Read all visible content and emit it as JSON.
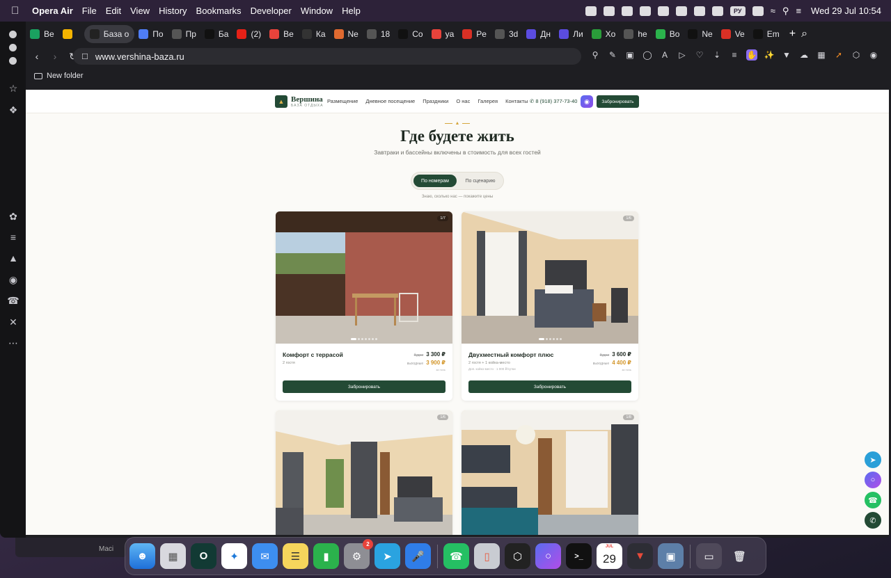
{
  "menubar": {
    "app": "Opera Air",
    "items": [
      "File",
      "Edit",
      "View",
      "History",
      "Bookmarks",
      "Developer",
      "Window",
      "Help"
    ],
    "lang": "РУ",
    "datetime": "Wed 29 Jul  10:54"
  },
  "tabs": [
    {
      "label": "Be",
      "color": "#1aa260",
      "icon": "sheets-icon"
    },
    {
      "label": "",
      "color": "#f5b400",
      "icon": "sun-icon"
    },
    {
      "label": "База о",
      "color": "#222222",
      "icon": "vershina-icon",
      "active": true
    },
    {
      "label": "По",
      "color": "#4f7df5",
      "icon": "spark-icon"
    },
    {
      "label": "Пр",
      "color": "#555555",
      "icon": "doc-icon"
    },
    {
      "label": "Ба",
      "color": "#111111",
      "icon": "vershina-icon"
    },
    {
      "label": "(2)",
      "color": "#e62117",
      "icon": "youtube-icon"
    },
    {
      "label": "Be",
      "color": "#e8433b",
      "icon": "pin-icon"
    },
    {
      "label": "Ка",
      "color": "#333333",
      "icon": "yandex-icon"
    },
    {
      "label": "Ne",
      "color": "#e06a30",
      "icon": "asterisk-icon"
    },
    {
      "label": "18",
      "color": "#555555",
      "icon": "doc-icon"
    },
    {
      "label": "Co",
      "color": "#111111",
      "icon": "notion-icon"
    },
    {
      "label": "ya",
      "color": "#e8433b",
      "icon": "yandex-y-icon"
    },
    {
      "label": "Pe",
      "color": "#d93025",
      "icon": "gmail-icon"
    },
    {
      "label": "3d",
      "color": "#555555",
      "icon": "doc-icon"
    },
    {
      "label": "Дн",
      "color": "#5b4ce0",
      "icon": "play-icon"
    },
    {
      "label": "Ли",
      "color": "#5b4ce0",
      "icon": "play-icon"
    },
    {
      "label": "Xo",
      "color": "#2a9d3a",
      "icon": "dollar-icon"
    },
    {
      "label": "he",
      "color": "#555555",
      "icon": "doc-icon"
    },
    {
      "label": "Bo",
      "color": "#2bb24c",
      "icon": "p-icon"
    },
    {
      "label": "Ne",
      "color": "#111111",
      "icon": "vershina-icon"
    },
    {
      "label": "Ve",
      "color": "#d93025",
      "icon": "gmail-icon"
    },
    {
      "label": "Em",
      "color": "#111111",
      "icon": "vershina-icon"
    }
  ],
  "address": {
    "url": "www.vershina-baza.ru"
  },
  "bookmarks": {
    "folder": "New folder"
  },
  "site": {
    "logo_title": "Вершина",
    "logo_sub": "БАЗА ОТДЫХА",
    "nav": [
      "Размещение",
      "Дневное посещение",
      "Праздники",
      "О нас",
      "Галерея",
      "Контакты"
    ],
    "phone": "8 (918) 377-73-40",
    "book": "Забронировать",
    "heading": "Где будете жить",
    "subheading": "Завтраки и бассейны включены в стоимость для всех гостей",
    "toggle_on": "По номерам",
    "toggle_off": "По сценарию",
    "hint": "Знаю, сколько нас — покажите цены",
    "cards": [
      {
        "name": "Комфорт с террасой",
        "guests": "2 гостя",
        "note": "",
        "weekday_label": "будни",
        "weekday_price": "3 300 ₽",
        "weekend_label": "выходные",
        "weekend_price": "3 900 ₽",
        "per": "за ночь",
        "counter": "1/7",
        "book": "Забронировать"
      },
      {
        "name": "Двухместный комфорт плюс",
        "guests": "2 гостя + 1 койка-место",
        "note": "Доп. койко-место · 1 000 ₽/сутки",
        "weekday_label": "будни",
        "weekday_price": "3 600 ₽",
        "weekend_label": "выходные",
        "weekend_price": "4 400 ₽",
        "per": "за ночь",
        "counter": "1/6",
        "book": "Забронировать"
      },
      {
        "counter": "1/6"
      },
      {
        "counter": "1/8"
      }
    ]
  },
  "dock": {
    "behind_label": "Maci",
    "badge": "2",
    "cal_month": "JUL",
    "cal_day": "29"
  }
}
